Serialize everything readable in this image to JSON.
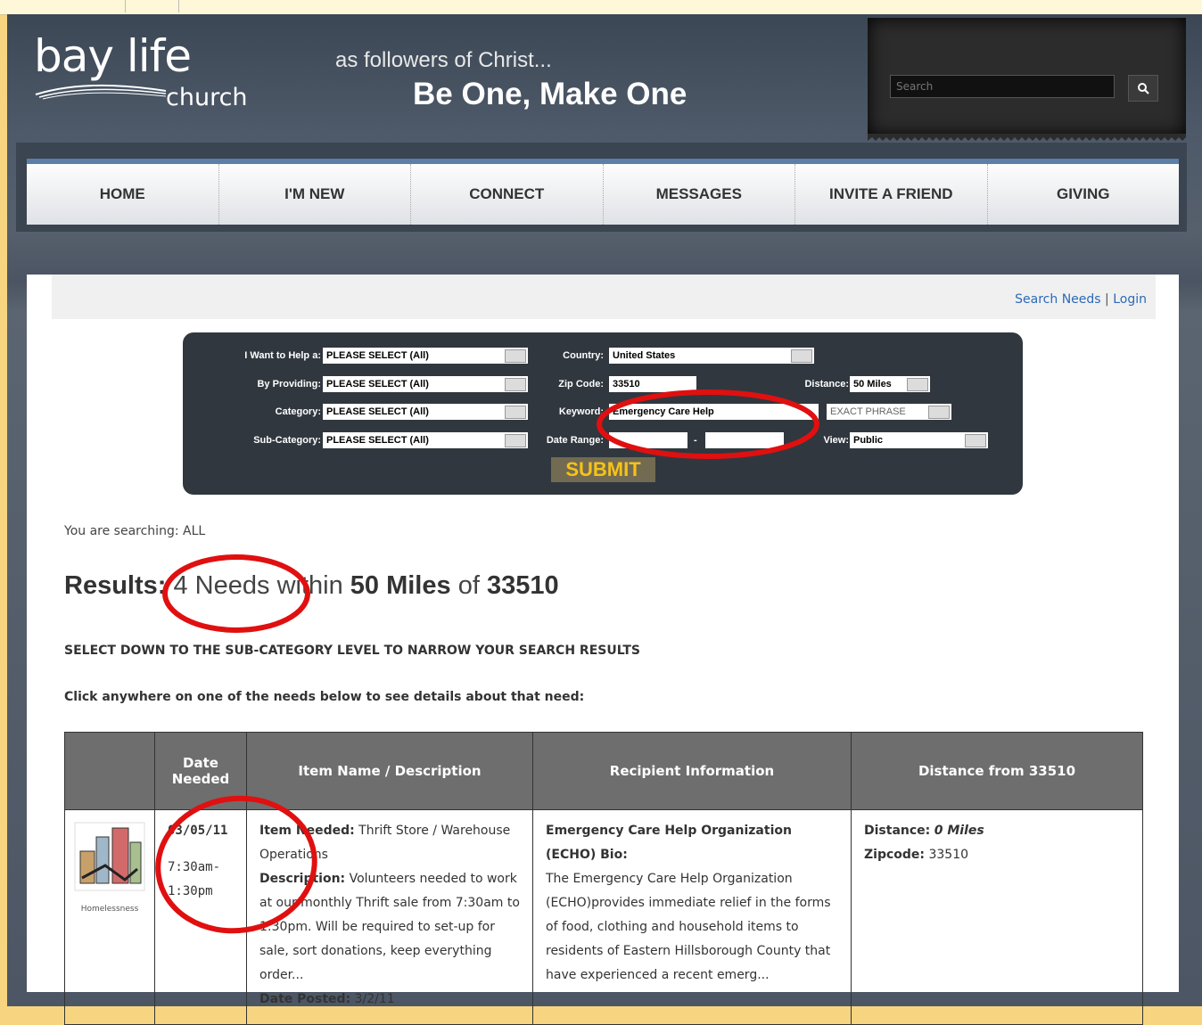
{
  "site": {
    "logo_bay": "bay life",
    "logo_church": "church",
    "tagline_small": "as followers of Christ...",
    "tagline_big": "Be One, Make One",
    "search_placeholder": "Search"
  },
  "nav": [
    "HOME",
    "I'M NEW",
    "CONNECT",
    "MESSAGES",
    "INVITE A FRIEND",
    "GIVING"
  ],
  "links": {
    "search_needs": "Search Needs",
    "login": "Login",
    "separator": "|"
  },
  "form": {
    "help_label": "I Want to Help a:",
    "help_value": "PLEASE SELECT (All)",
    "providing_label": "By Providing:",
    "providing_value": "PLEASE SELECT (All)",
    "category_label": "Category:",
    "category_value": "PLEASE SELECT (All)",
    "subcategory_label": "Sub-Category:",
    "subcategory_value": "PLEASE SELECT (All)",
    "country_label": "Country:",
    "country_value": "United States",
    "zip_label": "Zip Code:",
    "zip_value": "33510",
    "keyword_label": "Keyword:",
    "keyword_value": "Emergency Care Help",
    "phrase_value": "EXACT PHRASE",
    "daterange_label": "Date Range:",
    "daterange_sep": "-",
    "distance_label": "Distance:",
    "distance_value": "50 Miles",
    "view_label": "View:",
    "view_value": "Public",
    "submit": "SUBMIT"
  },
  "searching": "You are searching: ALL",
  "results": {
    "label": "Results:",
    "count": "4 Needs",
    "within": "within",
    "distance": "50 Miles",
    "of": "of",
    "zip": "33510"
  },
  "narrow_text": "SELECT DOWN TO THE SUB-CATEGORY LEVEL TO NARROW YOUR SEARCH RESULTS",
  "click_text": "Click anywhere on one of the needs below to see details about that need:",
  "table": {
    "headers": [
      "",
      "Date Needed",
      "Item Name / Description",
      "Recipient Information",
      "Distance from 33510"
    ],
    "row": {
      "icon_caption": "Homelessness",
      "date": "03/05/11",
      "time": "7:30am-1:30pm",
      "item_label": "Item Needed:",
      "item_value": "Thrift Store / Warehouse Operations",
      "desc_label": "Description:",
      "desc_value": "Volunteers needed to work at our monthly Thrift sale from 7:30am to 1:30pm. Will be required to set-up for sale, sort donations, keep everything order...",
      "posted_label": "Date Posted:",
      "posted_value": "3/2/11",
      "recipient_title": "Emergency Care Help Organization (ECHO) Bio:",
      "recipient_text": "The Emergency Care Help Organization (ECHO)provides immediate relief in the forms of food, clothing and household items to residents of Eastern Hillsborough County that have experienced a recent emerg...",
      "distance_label": "Distance:",
      "distance_value": "0 Miles",
      "zip_label": "Zipcode:",
      "zip_value": "33510"
    }
  },
  "colors": {
    "annotation": "#e01010",
    "link": "#2a6ab8",
    "submit_text": "#f6c21b"
  }
}
